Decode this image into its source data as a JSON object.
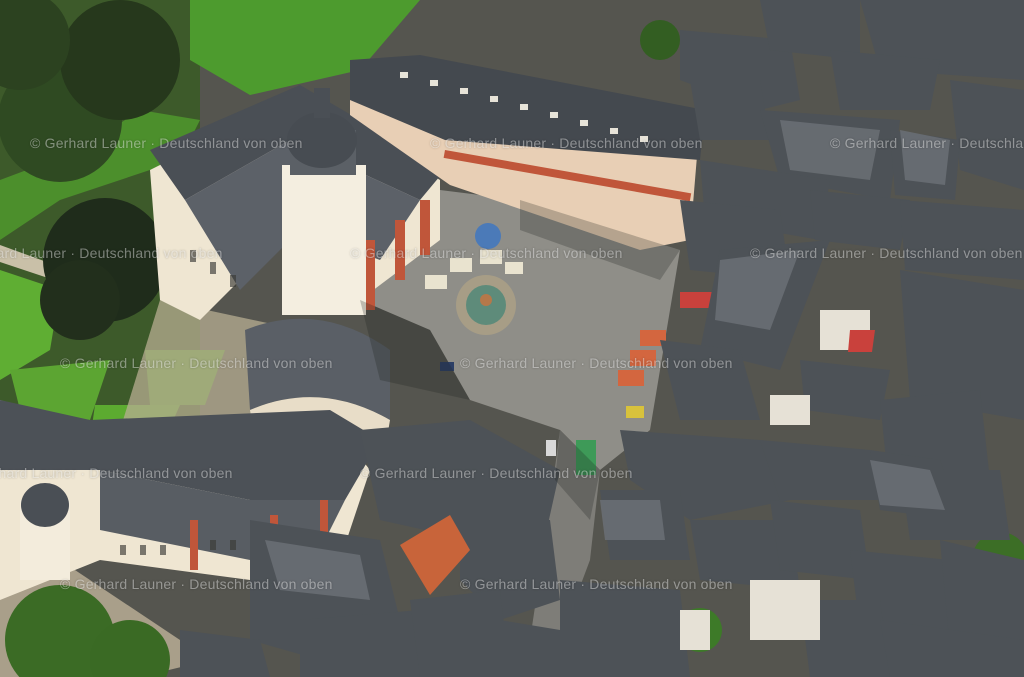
{
  "watermark": {
    "text": "© Gerhard Launer · Deutschland von oben",
    "repeat_count": 12
  },
  "palette": {
    "roof_slate": "#3f4347",
    "roof_slate_light": "#6b7075",
    "wall_cream": "#efe6d2",
    "wall_red": "#c0563a",
    "plaza_cobble": "#8d8c86",
    "lawn_green": "#4e9a2c",
    "tree_dark": "#2a3a22",
    "roof_orange": "#c8643a"
  },
  "scene": {
    "subjects": [
      "baroque-palace",
      "market-square",
      "fountain",
      "slate-roofed-houses",
      "palace-garden"
    ]
  }
}
